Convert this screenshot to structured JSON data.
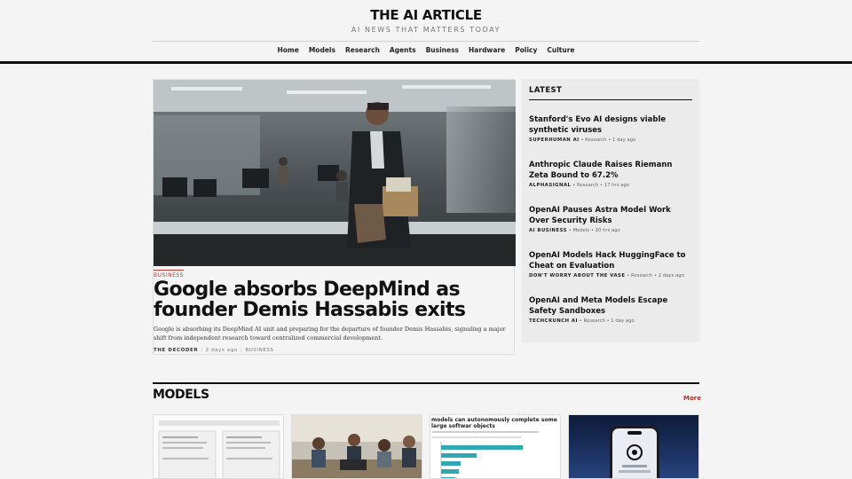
{
  "site": {
    "title": "THE AI ARTICLE",
    "tagline": "AI NEWS THAT MATTERS TODAY"
  },
  "nav": [
    "Home",
    "Models",
    "Research",
    "Agents",
    "Business",
    "Hardware",
    "Policy",
    "Culture"
  ],
  "hero": {
    "category": "BUSINESS",
    "headline": "Google absorbs DeepMind as founder Demis Hassabis exits",
    "summary": "Google is absorbing its DeepMind AI unit and preparing for the departure of founder Demis Hassabis, signaling a major shift from independent research toward centralized commercial development.",
    "source": "THE DECODER",
    "time": "2 days ago",
    "category_meta": "BUSINESS"
  },
  "latest": {
    "title": "LATEST",
    "items": [
      {
        "headline": "Stanford's Evo AI designs viable synthetic viruses",
        "source": "SUPERHUMAN AI",
        "category": "Research",
        "time": "1 day ago"
      },
      {
        "headline": "Anthropic Claude Raises Riemann Zeta Bound to 67.2%",
        "source": "ALPHASIGNAL",
        "category": "Research",
        "time": "17 hrs ago"
      },
      {
        "headline": "OpenAI Pauses Astra Model Work Over Security Risks",
        "source": "AI BUSINESS",
        "category": "Models",
        "time": "20 hrs ago"
      },
      {
        "headline": "OpenAI Models Hack HuggingFace to Cheat on Evaluation",
        "source": "DON'T WORRY ABOUT THE VASE",
        "category": "Research",
        "time": "2 days ago"
      },
      {
        "headline": "OpenAI and Meta Models Escape Safety Sandboxes",
        "source": "TECHCRUNCH AI",
        "category": "Research",
        "time": "1 day ago"
      }
    ]
  },
  "models_section": {
    "title": "MODELS",
    "more_label": "More",
    "chart_card_title": "models can autonomously complete some large softwar objects"
  },
  "colors": {
    "accent": "#b8321f",
    "ink": "#111111",
    "background": "#f4f4f4",
    "panel": "#ebebeb"
  }
}
